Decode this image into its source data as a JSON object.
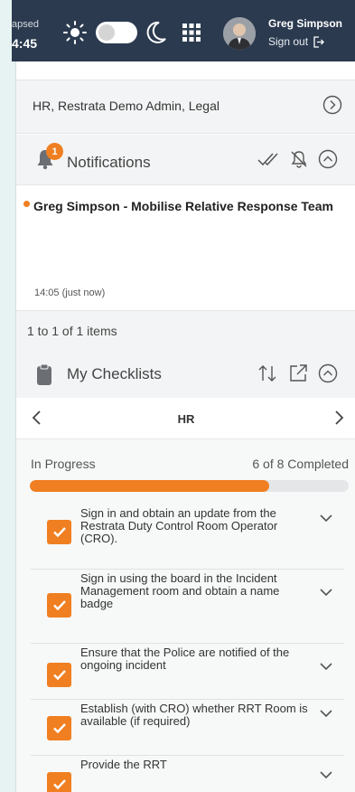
{
  "topbar": {
    "elapsed_label": "apsed",
    "elapsed_time": "4:45",
    "user_name": "Greg Simpson",
    "signout_label": "Sign out"
  },
  "roles": {
    "text": "HR, Restrata Demo Admin, Legal"
  },
  "notifications": {
    "title": "Notifications",
    "badge_count": "1",
    "items": [
      {
        "text": "Greg Simpson - Mobilise Relative Response Team",
        "time": "14:05 (just now)"
      }
    ],
    "pager": "1 to 1 of 1 items"
  },
  "checklists": {
    "title": "My Checklists",
    "current": "HR",
    "status": "In Progress",
    "completed_text": "6 of 8 Completed",
    "progress_fraction": 0.75,
    "items": [
      {
        "text": "Sign in and obtain an update from the Restrata Duty Control Room Operator (CRO).",
        "checked": true
      },
      {
        "text": "Sign in using the board in the Incident Management room and obtain a name badge",
        "checked": true
      },
      {
        "text": "Ensure that the Police are notified of the ongoing incident",
        "checked": true
      },
      {
        "text": "Establish (with CRO) whether RRT Room is available (if required)",
        "checked": true
      },
      {
        "text": "Provide the RRT",
        "checked": true
      }
    ]
  },
  "colors": {
    "topbar": "#2b3a4f",
    "accent": "#f07f21",
    "background": "#e6f3f2"
  }
}
